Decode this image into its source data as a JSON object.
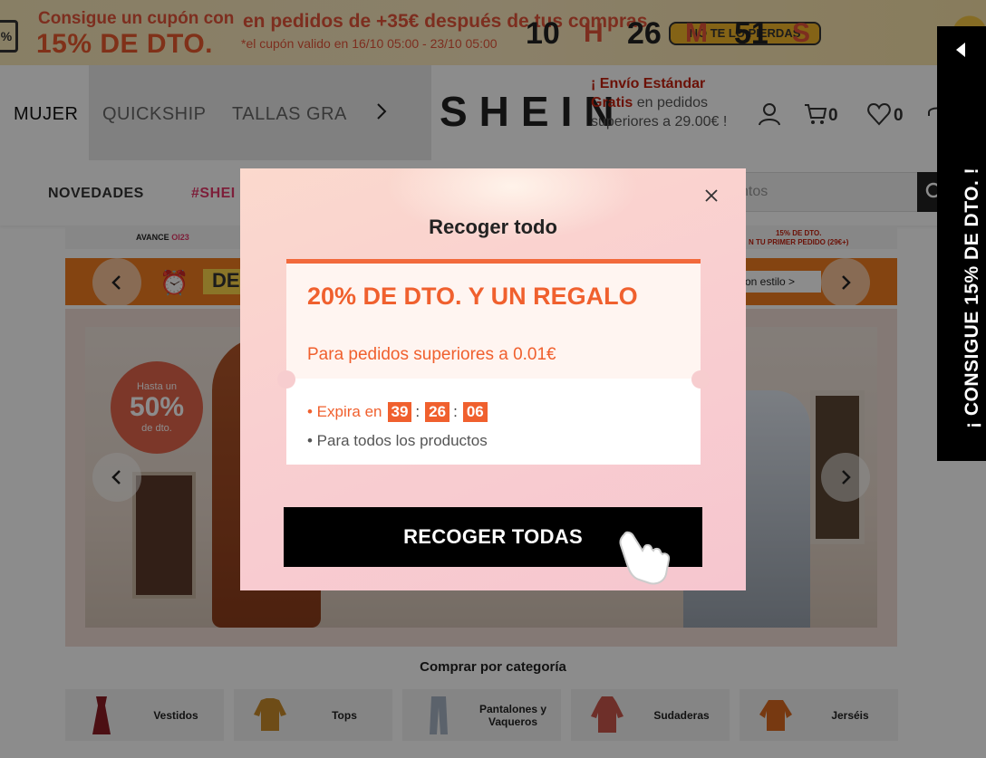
{
  "promo": {
    "line1": "Consigue un cupón con",
    "line2": "15% DE DTO.",
    "line3": "en pedidos de +35€ después de tus compras",
    "line4": "*el cupón valido en 16/10 05:00 - 23/10 05:00",
    "countdown": {
      "hours": "10",
      "hours_unit": "H",
      "minutes": "26",
      "minutes_unit": "M",
      "seconds": "51",
      "seconds_unit": "S"
    },
    "pill": "NO TE LO PIERDAS"
  },
  "header": {
    "categories": [
      "MUJER",
      "QUICKSHIP",
      "TALLAS GRA"
    ],
    "logo": "SHEIN",
    "shipping": {
      "red1": "¡ Envío Estándar",
      "red2": "Gratis",
      "text": " en pedidos superiores a 29.00€ !"
    },
    "cart_count": "0",
    "wishlist_count": "0"
  },
  "nav": {
    "items": [
      "NOVEDADES",
      "#SHEI"
    ],
    "search_placeholder": "ntos"
  },
  "page": {
    "strip_left": "AVANCE",
    "strip_left_accent": "OI23",
    "strip_right_1": "15% DE DTO.",
    "strip_right_2": "N TU PRIMER PEDIDO  (29€+)",
    "orange_left": "DE",
    "orange_right": "on estilo >",
    "badge_1": "Hasta un",
    "badge_2": "50%",
    "badge_3": "de dto.",
    "section_title": "Comprar por categoría",
    "categories": [
      {
        "label": "Vestidos",
        "color": "#8a1c24"
      },
      {
        "label": "Tops",
        "color": "#c98a2a"
      },
      {
        "label": "Pantalones y Vaqueros",
        "color": "#a6b3c4"
      },
      {
        "label": "Sudaderas",
        "color": "#c9564c"
      },
      {
        "label": "Jerséis",
        "color": "#d9691f"
      }
    ]
  },
  "side_banner": {
    "text": "¡ CONSIGUE 15% DE DTO. !"
  },
  "modal": {
    "title": "Recoger todo",
    "coupon_heading": "20% DE DTO. Y UN REGALO",
    "coupon_sub": "Para pedidos superiores a 0.01€",
    "expires_label": "• Expira en",
    "expires": {
      "h": "39",
      "m": "26",
      "s": "06"
    },
    "all_products": "• Para todos los productos",
    "cta": "RECOGER TODAS"
  },
  "colors": {
    "accent": "#f0602e",
    "brand": "#222222",
    "side_banner": "#000000"
  }
}
